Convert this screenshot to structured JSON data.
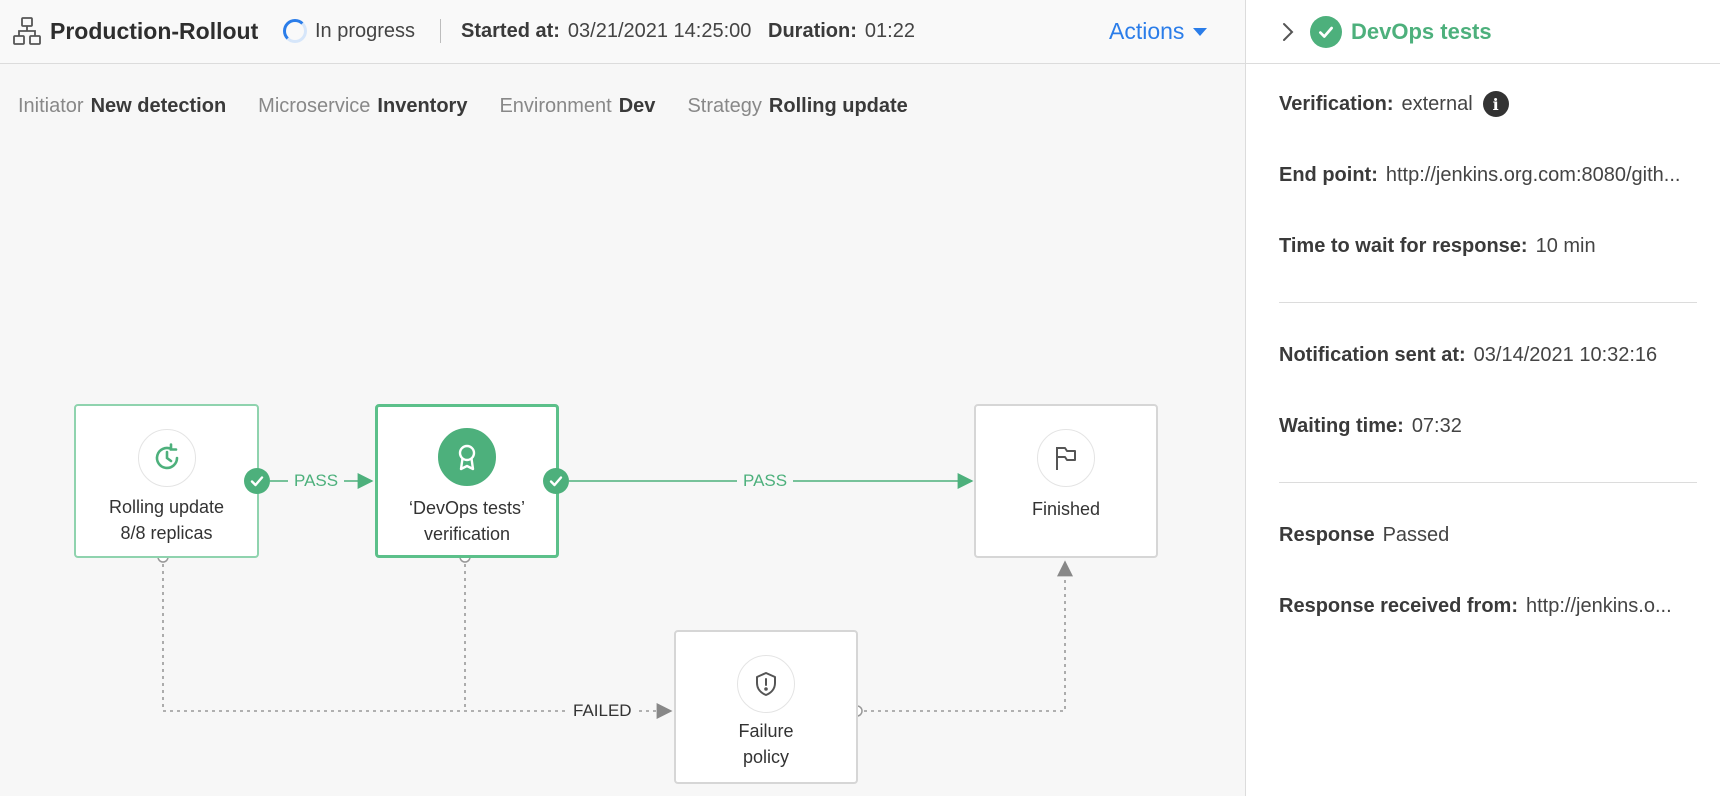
{
  "header": {
    "title": "Production-Rollout",
    "status": "In progress",
    "started_label": "Started at:",
    "started_value": "03/21/2021 14:25:00",
    "duration_label": "Duration:",
    "duration_value": "01:22",
    "actions_label": "Actions"
  },
  "meta": [
    {
      "key": "Initiator",
      "value": "New detection"
    },
    {
      "key": "Microservice",
      "value": "Inventory"
    },
    {
      "key": "Environment",
      "value": "Dev"
    },
    {
      "key": "Strategy",
      "value": "Rolling update"
    }
  ],
  "flow": {
    "nodes": {
      "rolling": {
        "line1": "Rolling update",
        "line2": "8/8 replicas",
        "icon": "clock-refresh-icon"
      },
      "devops": {
        "line1": "‘DevOps tests’",
        "line2": "verification",
        "icon": "award-icon"
      },
      "finished": {
        "line1": "Finished",
        "icon": "flag-icon"
      },
      "failure": {
        "line1": "Failure",
        "line2": "policy",
        "icon": "shield-alert-icon"
      }
    },
    "edges": {
      "pass1": "PASS",
      "pass2": "PASS",
      "failed": "FAILED"
    }
  },
  "panel": {
    "title": "DevOps tests",
    "rows": {
      "verification": {
        "label": "Verification:",
        "value": "external"
      },
      "endpoint": {
        "label": "End point:",
        "value": "http://jenkins.org.com:8080/gith..."
      },
      "wait": {
        "label": "Time to wait for response:",
        "value": "10 min"
      },
      "notification": {
        "label": "Notification sent at:",
        "value": "03/14/2021 10:32:16"
      },
      "waiting": {
        "label": "Waiting time:",
        "value": "07:32"
      },
      "response": {
        "label": "Response",
        "value": "Passed"
      },
      "received": {
        "label": "Response received from:",
        "value": "http://jenkins.o..."
      }
    }
  },
  "colors": {
    "accent_green": "#4db07c",
    "link_blue": "#2b7de9"
  }
}
